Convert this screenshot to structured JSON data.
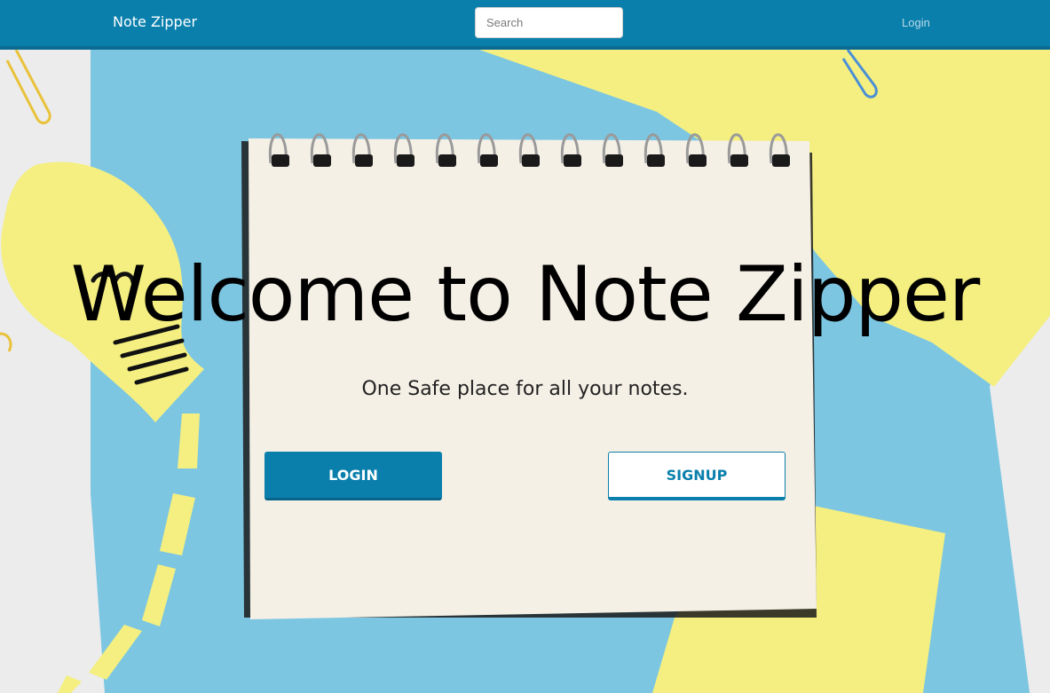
{
  "navbar": {
    "brand": "Note Zipper",
    "search_placeholder": "Search",
    "login_link": "Login"
  },
  "hero": {
    "title": "Welcome to Note Zipper",
    "subtitle": "One Safe place for all your notes.",
    "login_button": "LOGIN",
    "signup_button": "SIGNUP"
  },
  "colors": {
    "primary": "#0a7fac",
    "paper_blue": "#7cc6e2",
    "paper_yellow": "#f4ef80",
    "notebook": "#f5f0e6"
  }
}
